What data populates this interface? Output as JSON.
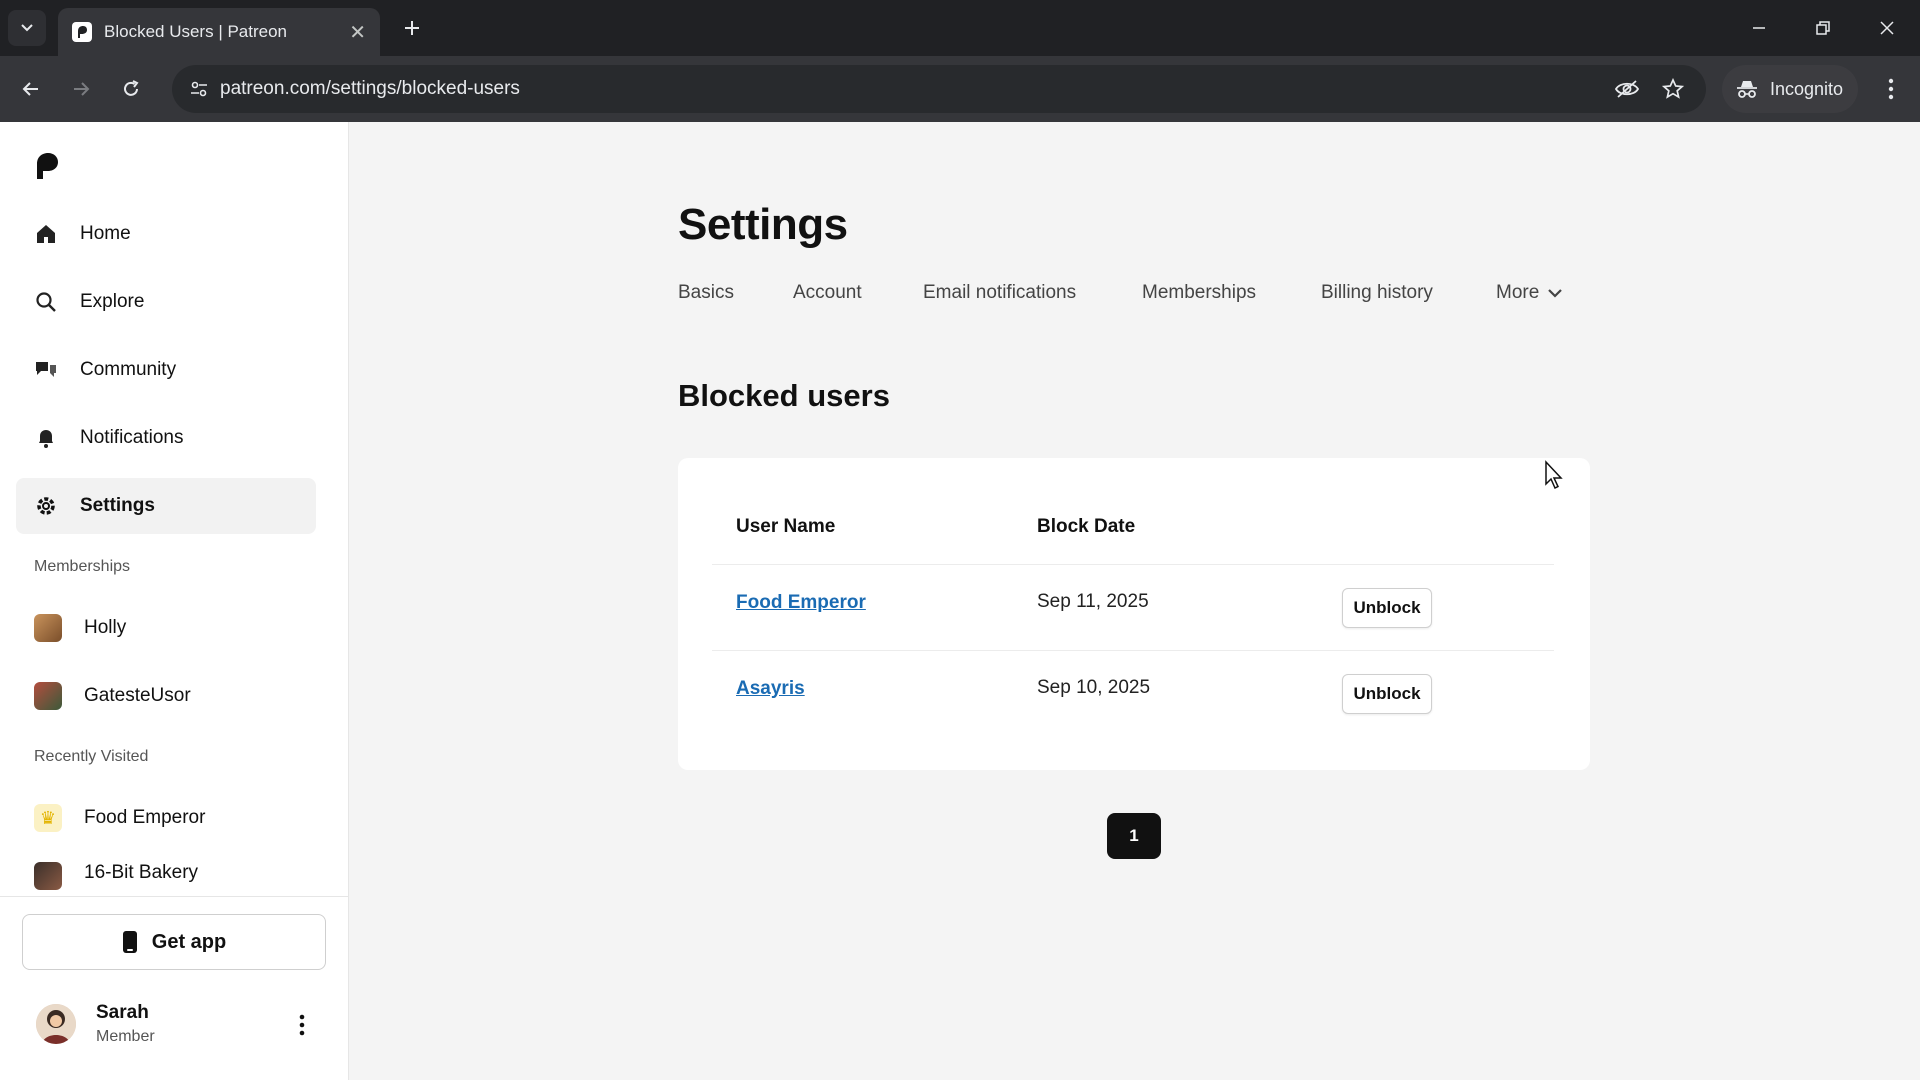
{
  "browser": {
    "tab_title": "Blocked Users | Patreon",
    "url": "patreon.com/settings/blocked-users",
    "incognito_label": "Incognito"
  },
  "sidebar": {
    "nav": [
      {
        "label": "Home",
        "icon": "home-icon"
      },
      {
        "label": "Explore",
        "icon": "search-icon"
      },
      {
        "label": "Community",
        "icon": "chat-bubbles-icon"
      },
      {
        "label": "Notifications",
        "icon": "bell-icon"
      },
      {
        "label": "Settings",
        "icon": "gear-icon",
        "active": true
      }
    ],
    "memberships_label": "Memberships",
    "memberships": [
      {
        "label": "Holly"
      },
      {
        "label": "GatesteUsor"
      }
    ],
    "recent_label": "Recently Visited",
    "recent": [
      {
        "label": "Food Emperor"
      },
      {
        "label": "16-Bit Bakery"
      }
    ],
    "get_app_label": "Get app",
    "user": {
      "name": "Sarah",
      "role": "Member"
    }
  },
  "main": {
    "title": "Settings",
    "tabs": [
      "Basics",
      "Account",
      "Email notifications",
      "Memberships",
      "Billing history",
      "More"
    ],
    "section_title": "Blocked users",
    "table": {
      "headers": [
        "User Name",
        "Block Date"
      ],
      "rows": [
        {
          "user": "Food Emperor",
          "date": "Sep 11, 2025",
          "action": "Unblock"
        },
        {
          "user": "Asayris",
          "date": "Sep 10, 2025",
          "action": "Unblock"
        }
      ]
    },
    "pagination": {
      "current_page": "1"
    }
  },
  "colors": {
    "link": "#1a6bb3",
    "chrome_dark": "#202124",
    "page_bg": "#f4f4f4"
  }
}
